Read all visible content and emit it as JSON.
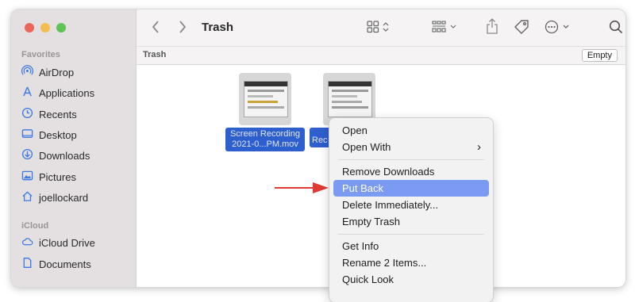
{
  "window": {
    "title": "Trash",
    "path_label": "Trash",
    "empty_button": "Empty"
  },
  "colors": {
    "close": "#ec6559",
    "minimize": "#f3bd4f",
    "zoom": "#5fc454",
    "selection": "#2e5fce",
    "menu_highlight": "#7b9bf2",
    "arrow": "#e03a33"
  },
  "toolbar_icons": [
    "back-icon",
    "forward-icon",
    "view-grid-icon",
    "group-icon",
    "share-icon",
    "tag-icon",
    "more-icon",
    "search-icon"
  ],
  "sidebar": {
    "favorites_label": "Favorites",
    "favorites": [
      {
        "label": "AirDrop",
        "icon": "airdrop-icon"
      },
      {
        "label": "Applications",
        "icon": "applications-icon"
      },
      {
        "label": "Recents",
        "icon": "clock-icon"
      },
      {
        "label": "Desktop",
        "icon": "desktop-icon"
      },
      {
        "label": "Downloads",
        "icon": "download-icon"
      },
      {
        "label": "Pictures",
        "icon": "pictures-icon"
      },
      {
        "label": "joellockard",
        "icon": "home-icon"
      }
    ],
    "icloud_label": "iCloud",
    "icloud": [
      {
        "label": "iCloud Drive",
        "icon": "cloud-icon"
      },
      {
        "label": "Documents",
        "icon": "document-icon"
      }
    ]
  },
  "files": [
    {
      "name_line1": "Screen Recording",
      "name_line2": "2021-0...PM.mov"
    },
    {
      "name_line1": "Rec",
      "name_line2": ""
    }
  ],
  "context_menu": {
    "items": [
      {
        "label": "Open"
      },
      {
        "label": "Open With",
        "submenu": true,
        "submenu_glyph": "›"
      },
      {
        "label": "Remove Downloads"
      },
      {
        "label": "Put Back",
        "highlighted": true
      },
      {
        "label": "Delete Immediately..."
      },
      {
        "label": "Empty Trash"
      },
      {
        "label": "Get Info"
      },
      {
        "label": "Rename 2 Items..."
      },
      {
        "label": "Quick Look"
      }
    ]
  }
}
